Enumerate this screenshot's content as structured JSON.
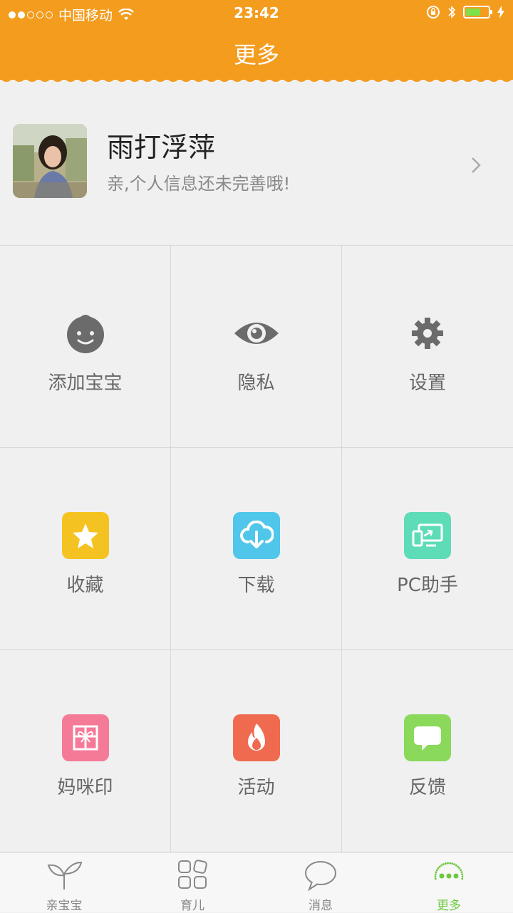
{
  "status_bar": {
    "carrier": "中国移动",
    "time": "23:42"
  },
  "header": {
    "title": "更多"
  },
  "profile": {
    "name": "雨打浮萍",
    "subtitle": "亲,个人信息还未完善哦!"
  },
  "grid": {
    "add_baby": "添加宝宝",
    "privacy": "隐私",
    "settings": "设置",
    "favorites": "收藏",
    "download": "下载",
    "pc_assistant": "PC助手",
    "mommy_print": "妈咪印",
    "activity": "活动",
    "feedback": "反馈"
  },
  "tabs": {
    "baby": "亲宝宝",
    "parenting": "育儿",
    "messages": "消息",
    "more": "更多"
  },
  "colors": {
    "header": "#f39c1e",
    "favorites": "#f5c321",
    "download": "#4fc6ea",
    "pc_assistant": "#5edcb8",
    "mommy_print": "#f47a98",
    "activity": "#f06a50",
    "feedback": "#8ad95a",
    "active_tab": "#6cc83c"
  },
  "icons": {
    "add_baby": "baby-face-icon",
    "privacy": "eye-icon",
    "settings": "gear-icon",
    "favorites": "star-icon",
    "download": "cloud-download-icon",
    "pc_assistant": "screen-sync-icon",
    "mommy_print": "gift-icon",
    "activity": "flame-icon",
    "feedback": "chat-bubble-icon"
  }
}
